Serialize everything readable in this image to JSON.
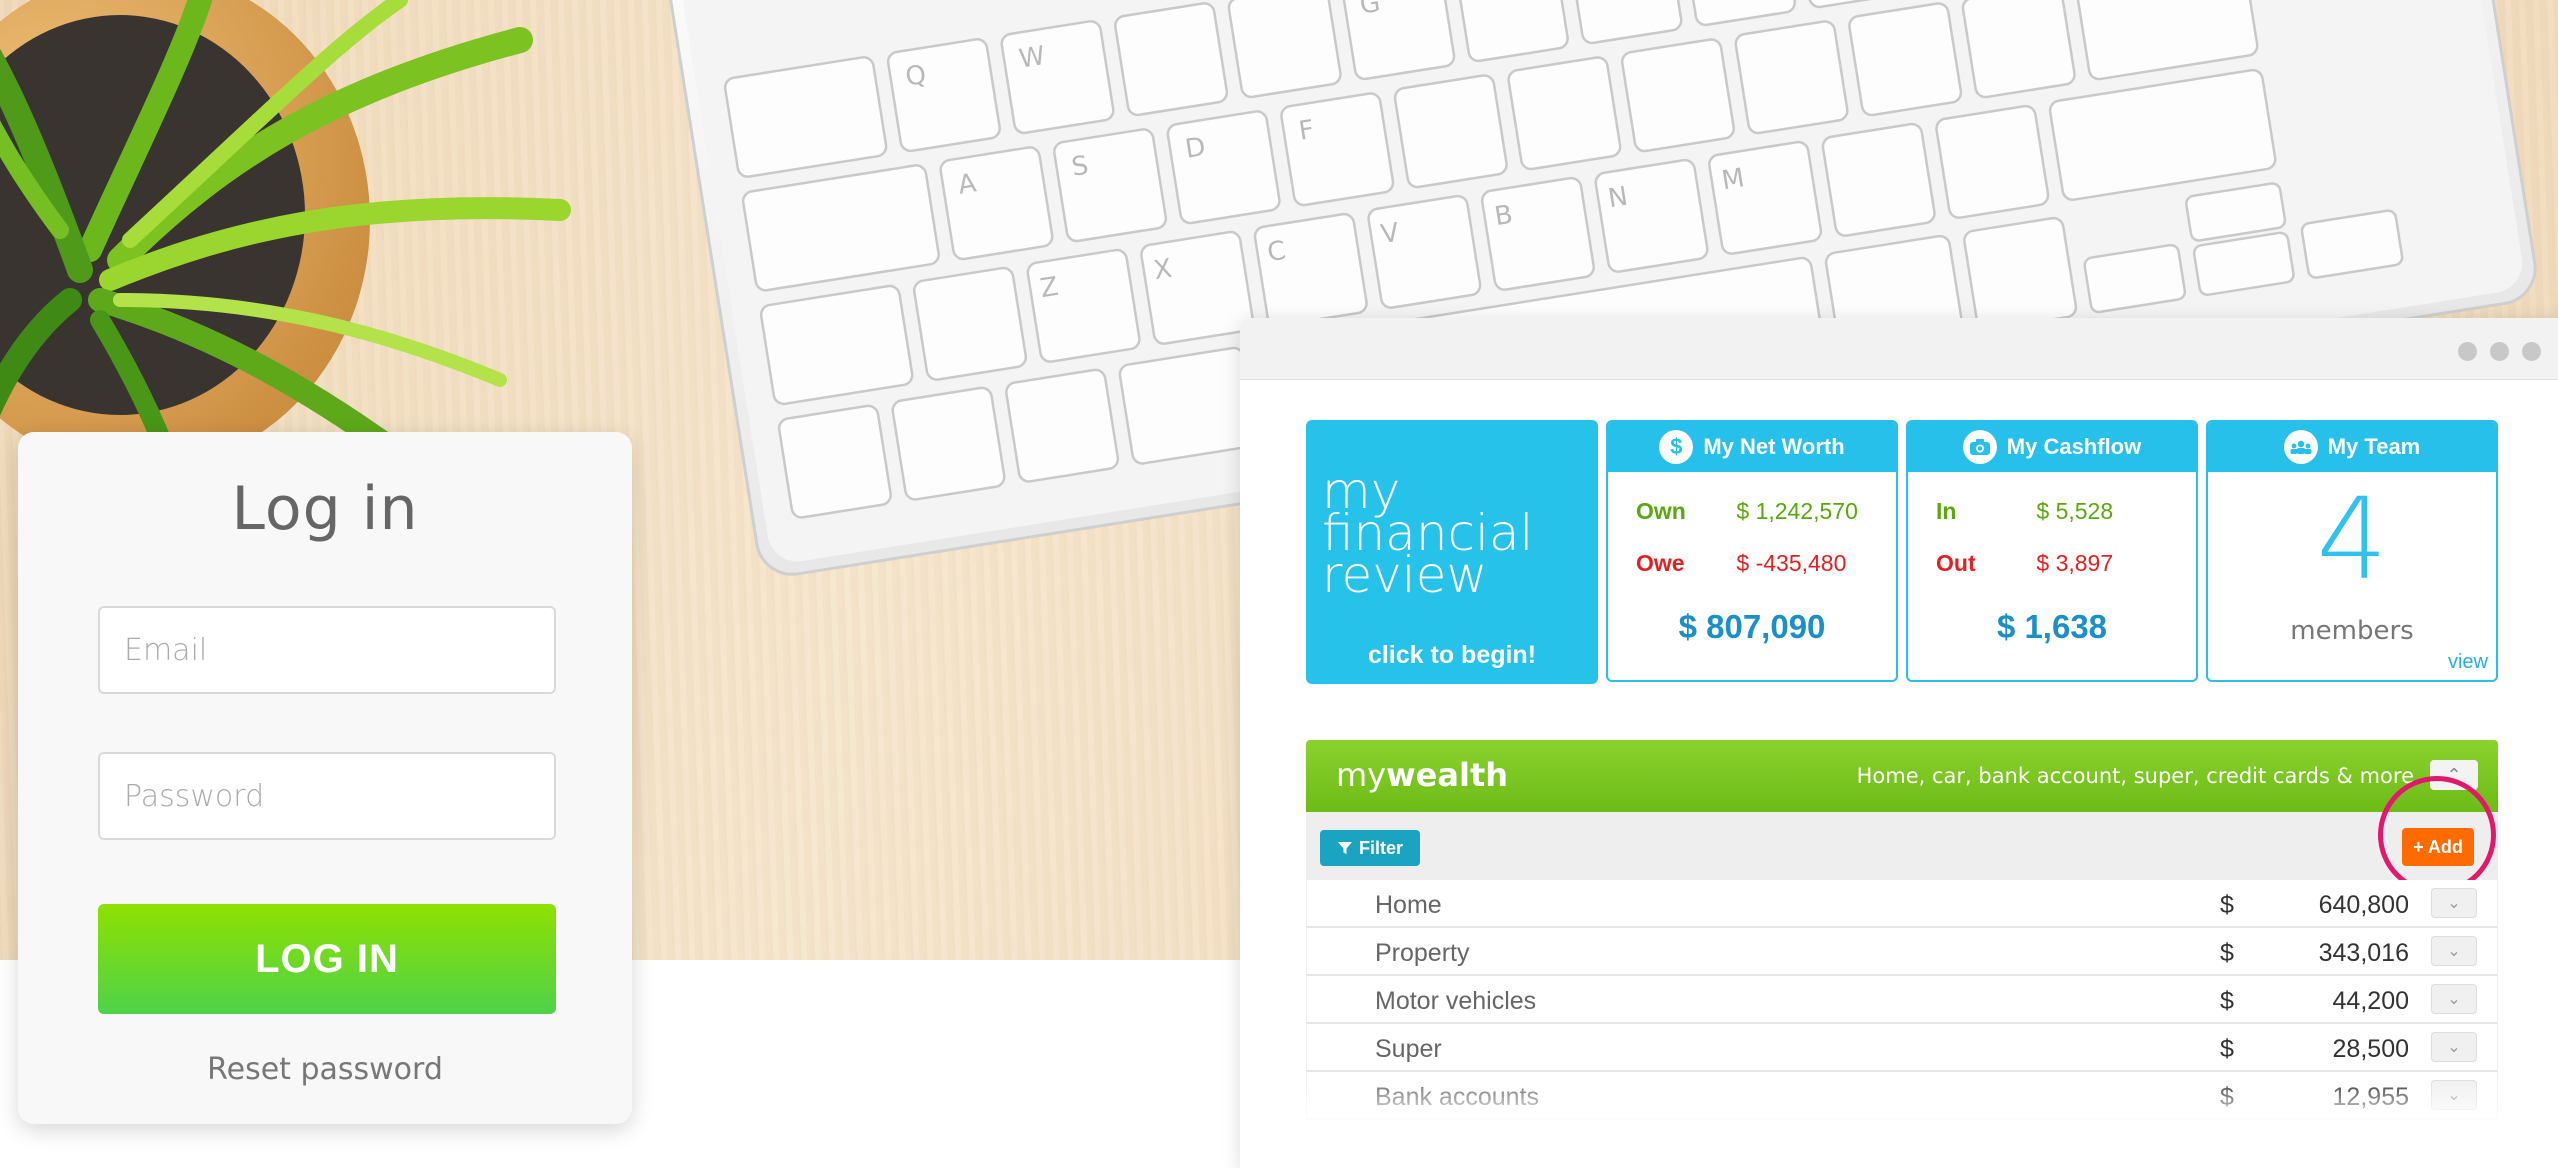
{
  "login": {
    "title": "Log in",
    "email_placeholder": "Email",
    "password_placeholder": "Password",
    "submit_label": "LOG IN",
    "reset_label": "Reset password"
  },
  "review_tile": {
    "line1": "my",
    "line2": "financial",
    "line3": "review",
    "cta": "click to begin!"
  },
  "net_worth": {
    "title": "My Net Worth",
    "icon": "dollar-icon",
    "own_label": "Own",
    "own_value": "$ 1,242,570",
    "owe_label": "Owe",
    "owe_value": "$ -435,480",
    "total": "$ 807,090"
  },
  "cashflow": {
    "title": "My Cashflow",
    "icon": "camera-icon",
    "in_label": "In",
    "in_value": "$ 5,528",
    "out_label": "Out",
    "out_value": "$ 3,897",
    "total": "$ 1,638"
  },
  "team": {
    "title": "My Team",
    "icon": "group-icon",
    "count": "4",
    "label": "members",
    "view_link": "view"
  },
  "wealth": {
    "title_prefix": "my",
    "title_bold": "wealth",
    "subtitle": "Home, car, bank account, super, credit cards & more",
    "filter_label": "Filter",
    "add_label": "+ Add",
    "items": [
      {
        "name": "Home",
        "currency": "$",
        "amount": "640,800"
      },
      {
        "name": "Property",
        "currency": "$",
        "amount": "343,016"
      },
      {
        "name": "Motor vehicles",
        "currency": "$",
        "amount": "44,200"
      },
      {
        "name": "Super",
        "currency": "$",
        "amount": "28,500"
      },
      {
        "name": "Bank accounts",
        "currency": "$",
        "amount": "12,955"
      }
    ]
  },
  "colors": {
    "accent_blue": "#27c0ea",
    "wealth_green": "#6dbb17",
    "add_orange": "#ff6b00",
    "highlight_ring": "#e2186b",
    "login_green": "#4ed24a"
  }
}
